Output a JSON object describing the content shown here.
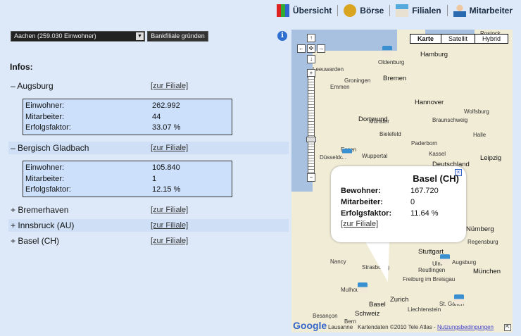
{
  "nav": [
    {
      "label": "Übersicht",
      "icon": "folders-icon"
    },
    {
      "label": "Börse",
      "icon": "coins-icon"
    },
    {
      "label": "Filialen",
      "icon": "house-icon"
    },
    {
      "label": "Mitarbeiter",
      "icon": "person-icon"
    }
  ],
  "city_select": {
    "value": "Aachen (259.030 Einwohner)"
  },
  "found_button": "Bankfiliale gründen",
  "infos_title": "Infos:",
  "link_label": "[zur Filiale]",
  "branches": [
    {
      "toggle": "–",
      "name": "Augsburg",
      "expanded": true,
      "details": [
        [
          "Einwohner:",
          "262.992"
        ],
        [
          "Mitarbeiter:",
          "44"
        ],
        [
          "Erfolgsfaktor:",
          "33.07 %"
        ]
      ]
    },
    {
      "toggle": "–",
      "name": "Bergisch Gladbach",
      "expanded": true,
      "details": [
        [
          "Einwohner:",
          "105.840"
        ],
        [
          "Mitarbeiter:",
          "1"
        ],
        [
          "Erfolgsfaktor:",
          "12.15 %"
        ]
      ]
    },
    {
      "toggle": "+",
      "name": "Bremerhaven",
      "expanded": false
    },
    {
      "toggle": "+",
      "name": "Innsbruck (AU)",
      "expanded": false
    },
    {
      "toggle": "+",
      "name": "Basel (CH)",
      "expanded": false
    }
  ],
  "map": {
    "types": [
      "Karte",
      "Satellit",
      "Hybrid"
    ],
    "selected_type": "Karte",
    "popup": {
      "title": "Basel (CH)",
      "rows": [
        [
          "Bewohner:",
          "167.720"
        ],
        [
          "Mitarbeiter:",
          "0"
        ],
        [
          "Erfolgsfaktor:",
          "11.64 %"
        ]
      ],
      "link": "[zur Filiale]"
    },
    "cities": [
      "Rostock",
      "Hamburg",
      "Oldenburg",
      "Bremen",
      "Groningen",
      "Leeuwarden",
      "Emmen",
      "Hannover",
      "Wolfsburg",
      "Münster",
      "Bielefeld",
      "Braunschweig",
      "Dortmund",
      "Paderborn",
      "Halle",
      "Essen",
      "Wuppertal",
      "Düsseldorf",
      "Kassel",
      "Leipzig",
      "Deutschland",
      "Nürnberg",
      "Regensburg",
      "Stuttgart",
      "Augsburg",
      "München",
      "Nancy",
      "Strasbourg",
      "Reutlingen",
      "Ulm",
      "Freiburg im Breisgau",
      "Mulhouse",
      "Basel",
      "Zurich",
      "St. Gallen",
      "Besançon",
      "Bern",
      "Schweiz",
      "Lausanne",
      "Liechtenstein"
    ],
    "logo": "Google",
    "attribution": "Kartendaten ©2010 Tele Atlas - ",
    "terms_link": "Nutzungsbedingungen"
  }
}
